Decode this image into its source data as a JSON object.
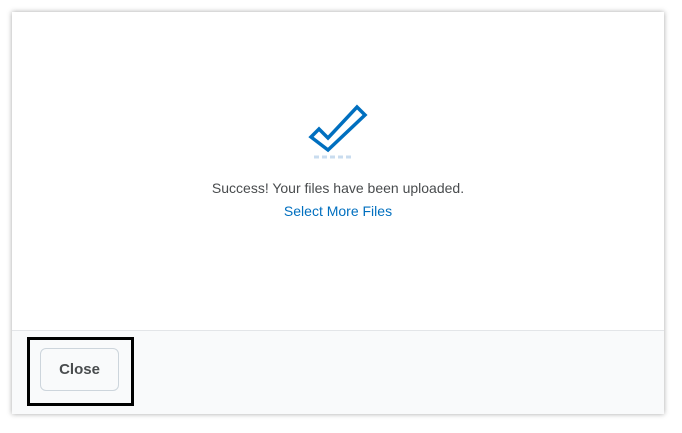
{
  "dialog": {
    "status_icon": "checkmark-icon",
    "success_message": "Success! Your files have been uploaded.",
    "select_more_label": "Select More Files",
    "close_label": "Close"
  },
  "colors": {
    "accent": "#006fbf",
    "text": "#494c4e",
    "footer_bg": "#f9fafb",
    "highlight": "#000000"
  }
}
